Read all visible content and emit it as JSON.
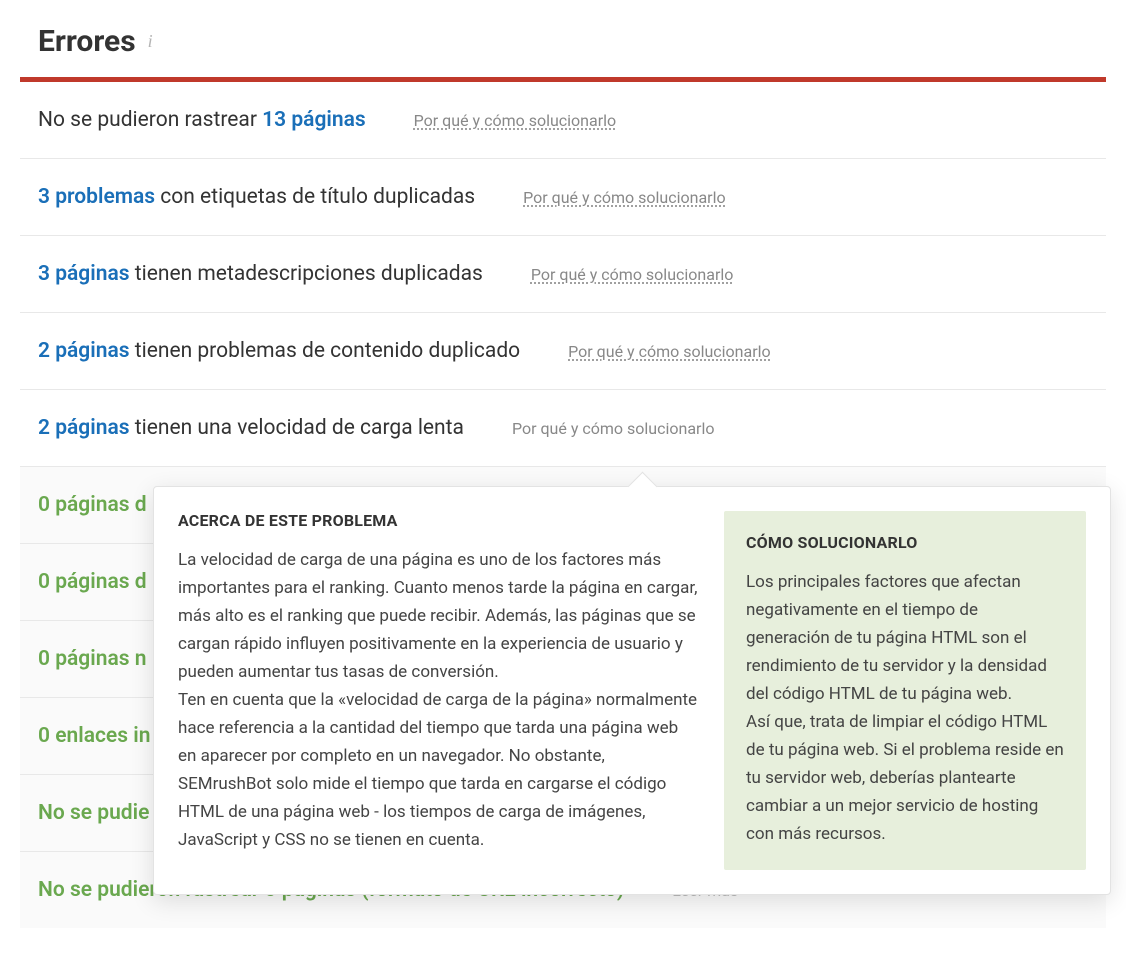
{
  "header": {
    "title": "Errores",
    "info_icon": "i"
  },
  "why_link_text": "Por qué y cómo solucionarlo",
  "leer_mas": "Leer más",
  "issues": [
    {
      "prefix": "No se pudieron rastrear ",
      "count": "13 páginas",
      "suffix": ""
    },
    {
      "prefix": "",
      "count": "3 problemas",
      "suffix": " con etiquetas de título duplicadas"
    },
    {
      "prefix": "",
      "count": "3 páginas",
      "suffix": " tienen metadescripciones duplicadas"
    },
    {
      "prefix": "",
      "count": "2 páginas",
      "suffix": " tienen problemas de contenido duplicado"
    },
    {
      "prefix": "",
      "count": "2 páginas",
      "suffix": " tienen una velocidad de carga lenta"
    }
  ],
  "zero_issues": [
    {
      "text": "0 páginas d"
    },
    {
      "text": "0 páginas d"
    },
    {
      "text": "0 páginas n"
    },
    {
      "text": "0 enlaces in"
    },
    {
      "text": "No se pudie"
    },
    {
      "text": "No se pudieron rastrear 0 páginas (formato de URL incorrecto)"
    }
  ],
  "tooltip": {
    "about_title": "ACERCA DE ESTE PROBLEMA",
    "about_text_1": "La velocidad de carga de una página es uno de los factores más importantes para el ranking. Cuanto menos tarde la página en cargar, más alto es el ranking que puede recibir. Además, las páginas que se cargan rápido influyen positivamente en la experiencia de usuario y pueden aumentar tus tasas de conversión.",
    "about_text_2": "Ten en cuenta que la «velocidad de carga de la página» normalmente hace referencia a la cantidad del tiempo que tarda una página web en aparecer por completo en un navegador. No obstante, SEMrushBot solo mide el tiempo que tarda en cargarse el código HTML de una página web - los tiempos de carga de imágenes, JavaScript y CSS no se tienen en cuenta.",
    "fix_title": "CÓMO SOLUCIONARLO",
    "fix_text_1": "Los principales factores que afectan negativamente en el tiempo de generación de tu página HTML son el rendimiento de tu servidor y la densidad del código HTML de tu página web.",
    "fix_text_2": "Así que, trata de limpiar el código HTML de tu página web. Si el problema reside en tu servidor web, deberías plantearte cambiar a un mejor servicio de hosting con más recursos."
  }
}
